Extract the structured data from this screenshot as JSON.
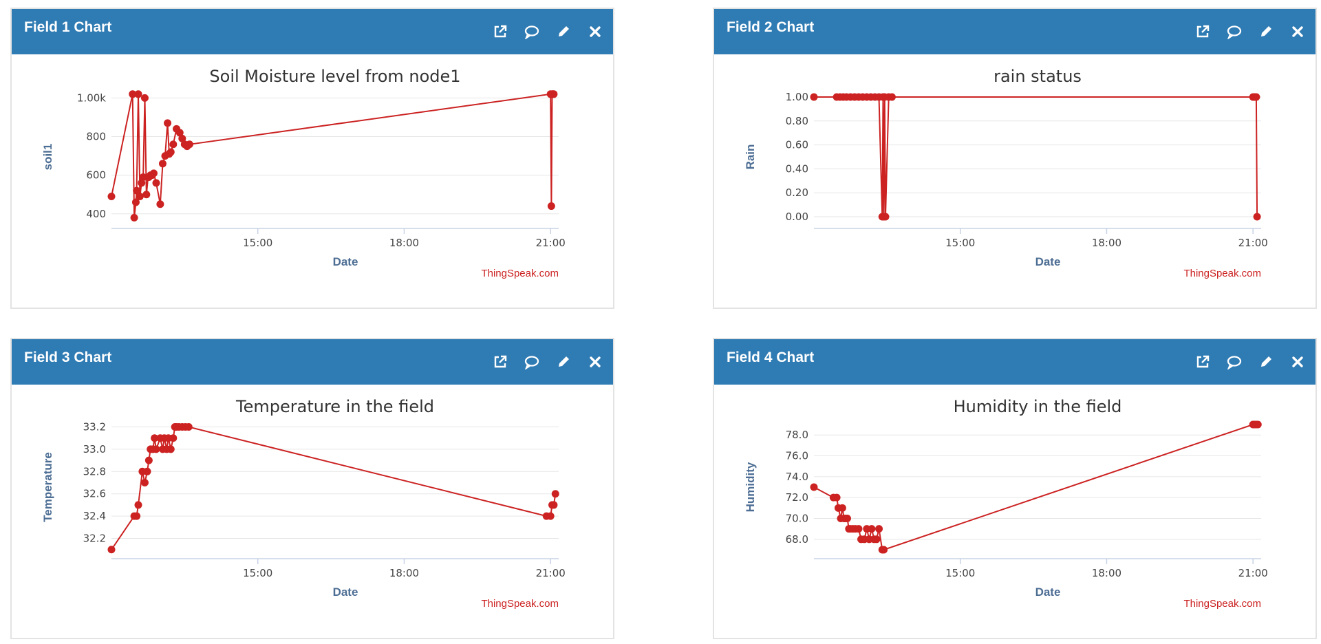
{
  "colors": {
    "header": "#2f7bb3",
    "series": "#cc2222",
    "grid": "#e6e6e6"
  },
  "icons": [
    "external-link-icon",
    "comment-icon",
    "pencil-icon",
    "close-icon"
  ],
  "panels": [
    {
      "header_title": "Field 1 Chart",
      "chart_data": {
        "type": "line",
        "title": "Soil Moisture level from node1",
        "xlabel": "Date",
        "ylabel": "soil1",
        "credit": "ThingSpeak.com",
        "xlim": [
          "12:00",
          "21:10"
        ],
        "xticks": [
          "15:00",
          "18:00",
          "21:00"
        ],
        "ylim": [
          360,
          1030
        ],
        "yticks": [
          400,
          600,
          800,
          1000
        ],
        "ytick_labels": [
          "400",
          "600",
          "800",
          "1.00k"
        ],
        "x": [
          "12:00",
          "12:26",
          "12:28",
          "12:30",
          "12:31",
          "12:33",
          "12:35",
          "12:37",
          "12:39",
          "12:41",
          "12:43",
          "12:45",
          "12:46",
          "12:48",
          "12:50",
          "12:52",
          "12:55",
          "13:00",
          "13:03",
          "13:06",
          "13:09",
          "13:11",
          "13:13",
          "13:16",
          "13:20",
          "13:24",
          "13:27",
          "13:30",
          "13:33",
          "13:36",
          "21:00",
          "21:01",
          "21:02",
          "21:03",
          "21:04"
        ],
        "y": [
          490,
          1020,
          380,
          460,
          520,
          1020,
          490,
          560,
          590,
          1000,
          500,
          590,
          590,
          600,
          600,
          610,
          560,
          450,
          660,
          700,
          870,
          710,
          720,
          760,
          840,
          820,
          790,
          760,
          750,
          760,
          1020,
          440,
          1020,
          1020,
          1020
        ]
      }
    },
    {
      "header_title": "Field 2 Chart",
      "chart_data": {
        "type": "line",
        "title": "rain status",
        "xlabel": "Date",
        "ylabel": "Rain",
        "credit": "ThingSpeak.com",
        "xlim": [
          "12:00",
          "21:10"
        ],
        "xticks": [
          "15:00",
          "18:00",
          "21:00"
        ],
        "ylim": [
          -0.04,
          1.04
        ],
        "yticks": [
          0,
          0.2,
          0.4,
          0.6,
          0.8,
          1.0
        ],
        "ytick_labels": [
          "0.00",
          "0.20",
          "0.40",
          "0.60",
          "0.80",
          "1.00"
        ],
        "x": [
          "12:00",
          "12:28",
          "12:32",
          "12:36",
          "12:40",
          "12:45",
          "12:50",
          "12:55",
          "13:00",
          "13:05",
          "13:10",
          "13:15",
          "13:20",
          "13:24",
          "13:25",
          "13:26",
          "13:27",
          "13:28",
          "13:32",
          "13:36",
          "21:00",
          "21:02",
          "21:04",
          "21:05"
        ],
        "y": [
          1,
          1,
          1,
          1,
          1,
          1,
          1,
          1,
          1,
          1,
          1,
          1,
          1,
          0,
          1,
          0,
          1,
          0,
          1,
          1,
          1,
          1,
          1,
          0
        ]
      }
    },
    {
      "header_title": "Field 3 Chart",
      "chart_data": {
        "type": "line",
        "title": "Temperature in the field",
        "xlabel": "Date",
        "ylabel": "Temperature",
        "credit": "ThingSpeak.com",
        "xlim": [
          "12:00",
          "21:10"
        ],
        "xticks": [
          "15:00",
          "18:00",
          "21:00"
        ],
        "ylim": [
          32.08,
          33.24
        ],
        "yticks": [
          32.2,
          32.4,
          32.6,
          32.8,
          33.0,
          33.2
        ],
        "ytick_labels": [
          "32.2",
          "32.4",
          "32.6",
          "32.8",
          "33.0",
          "33.2"
        ],
        "x": [
          "12:00",
          "12:28",
          "12:31",
          "12:33",
          "12:38",
          "12:41",
          "12:44",
          "12:46",
          "12:48",
          "12:51",
          "12:53",
          "12:55",
          "13:00",
          "13:03",
          "13:05",
          "13:08",
          "13:10",
          "13:13",
          "13:16",
          "13:18",
          "13:20",
          "13:23",
          "13:27",
          "13:31",
          "13:35",
          "20:55",
          "21:00",
          "21:02",
          "21:04",
          "21:06"
        ],
        "y": [
          32.1,
          32.4,
          32.4,
          32.5,
          32.8,
          32.7,
          32.8,
          32.9,
          33.0,
          33.0,
          33.1,
          33.0,
          33.1,
          33.0,
          33.1,
          33.0,
          33.1,
          33.0,
          33.1,
          33.2,
          33.2,
          33.2,
          33.2,
          33.2,
          33.2,
          32.4,
          32.4,
          32.5,
          32.5,
          32.6
        ]
      }
    },
    {
      "header_title": "Field 4 Chart",
      "chart_data": {
        "type": "line",
        "title": "Humidity in the field",
        "xlabel": "Date",
        "ylabel": "Humidity",
        "credit": "ThingSpeak.com",
        "xlim": [
          "12:00",
          "21:10"
        ],
        "xticks": [
          "15:00",
          "18:00",
          "21:00"
        ],
        "ylim": [
          66.8,
          79.2
        ],
        "yticks": [
          68,
          70,
          72,
          74,
          76,
          78
        ],
        "ytick_labels": [
          "68.0",
          "70.0",
          "72.0",
          "74.0",
          "76.0",
          "78.0"
        ],
        "x": [
          "12:00",
          "12:24",
          "12:28",
          "12:30",
          "12:33",
          "12:35",
          "12:37",
          "12:39",
          "12:41",
          "12:43",
          "12:45",
          "12:48",
          "12:51",
          "12:55",
          "12:58",
          "13:02",
          "13:05",
          "13:08",
          "13:11",
          "13:14",
          "13:17",
          "13:20",
          "13:24",
          "13:26",
          "21:00",
          "21:02",
          "21:04",
          "21:06"
        ],
        "y": [
          73,
          72,
          72,
          71,
          70,
          71,
          70,
          70,
          70,
          69,
          69,
          69,
          69,
          69,
          68,
          68,
          69,
          68,
          69,
          68,
          68,
          69,
          67,
          67,
          79,
          79,
          79,
          79
        ]
      }
    }
  ]
}
